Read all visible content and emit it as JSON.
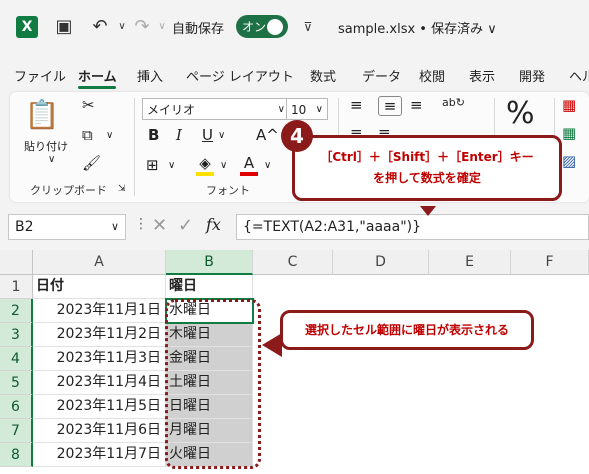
{
  "titlebar": {
    "logo": "X",
    "save_icon": "save-icon",
    "undo_icon": "undo-icon",
    "redo_icon": "redo-icon",
    "autosave_label": "自動保存",
    "toggle_label": "オン",
    "customize_icon": "qat-customize-icon",
    "file_title": "sample.xlsx • 保存済み ∨"
  },
  "tabs": [
    "ファイル",
    "ホーム",
    "挿入",
    "ページ レイアウト",
    "数式",
    "データ",
    "校閲",
    "表示",
    "開発",
    "ヘル"
  ],
  "ribbon": {
    "paste_label": "貼り付け",
    "clipboard_label": "クリップボード",
    "font_name": "メイリオ",
    "font_size": "10",
    "bold": "B",
    "italic": "I",
    "underline": "U",
    "grow_font": "A^",
    "fill_letter": "A",
    "font_group_label": "フォント",
    "percent": "%"
  },
  "formula_bar": {
    "name_box": "B2",
    "fx": "fx",
    "formula": "{=TEXT(A2:A31,\"aaaa\")}"
  },
  "columns": [
    "A",
    "B",
    "C",
    "D",
    "E",
    "F"
  ],
  "rows": [
    {
      "num": "1",
      "a": "日付",
      "b": "曜日"
    },
    {
      "num": "2",
      "a": "2023年11月1日",
      "b": "水曜日"
    },
    {
      "num": "3",
      "a": "2023年11月2日",
      "b": "木曜日"
    },
    {
      "num": "4",
      "a": "2023年11月3日",
      "b": "金曜日"
    },
    {
      "num": "5",
      "a": "2023年11月4日",
      "b": "土曜日"
    },
    {
      "num": "6",
      "a": "2023年11月5日",
      "b": "日曜日"
    },
    {
      "num": "7",
      "a": "2023年11月6日",
      "b": "月曜日"
    },
    {
      "num": "8",
      "a": "2023年11月7日",
      "b": "火曜日"
    }
  ],
  "annotations": {
    "step_number": "4",
    "step_text_line1": "［Ctrl］＋［Shift］＋［Enter］キー",
    "step_text_line2": "を押して数式を確定",
    "result_text": "選択したセル範囲に曜日が表示される"
  },
  "colors": {
    "accent": "#107c41",
    "callout": "#8b1a1a",
    "callout_text": "#c00000"
  }
}
